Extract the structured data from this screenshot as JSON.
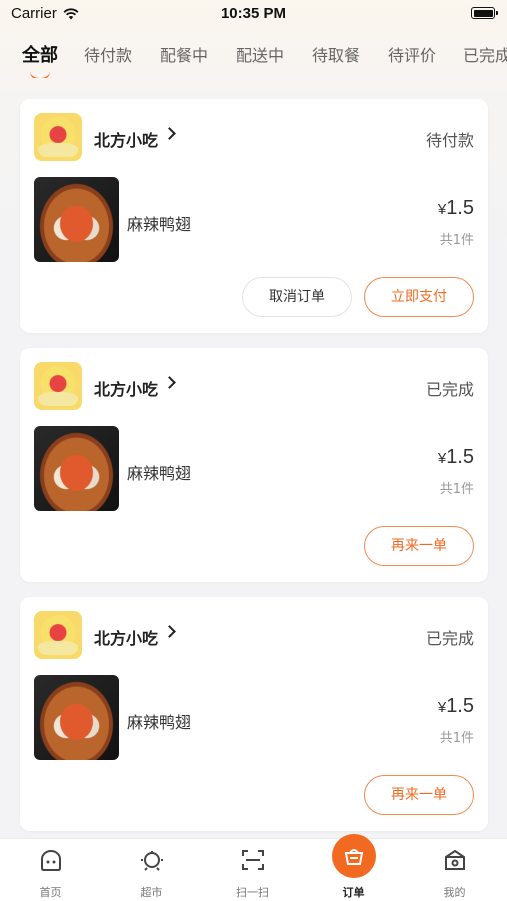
{
  "status_bar": {
    "carrier": "Carrier",
    "time": "10:35 PM"
  },
  "tabs": [
    "全部",
    "待付款",
    "配餐中",
    "配送中",
    "待取餐",
    "待评价",
    "已完成"
  ],
  "active_tab": 0,
  "orders": [
    {
      "shop_name": "北方小吃",
      "status": "待付款",
      "dish_name": "麻辣鸭翅",
      "currency": "¥",
      "price": "1.5",
      "count": "共1件",
      "actions": [
        "取消订单",
        "立即支付"
      ]
    },
    {
      "shop_name": "北方小吃",
      "status": "已完成",
      "dish_name": "麻辣鸭翅",
      "currency": "¥",
      "price": "1.5",
      "count": "共1件",
      "actions": [
        "再来一单"
      ]
    },
    {
      "shop_name": "北方小吃",
      "status": "已完成",
      "dish_name": "麻辣鸭翅",
      "currency": "¥",
      "price": "1.5",
      "count": "共1件",
      "actions": [
        "再来一单"
      ]
    }
  ],
  "tabbar": [
    {
      "label": "首页",
      "icon": "home-icon"
    },
    {
      "label": "超市",
      "icon": "supermarket-icon"
    },
    {
      "label": "扫一扫",
      "icon": "scan-icon"
    },
    {
      "label": "订单",
      "icon": "orders-icon",
      "active": true
    },
    {
      "label": "我的",
      "icon": "profile-icon"
    }
  ],
  "colors": {
    "accent": "#f26a22",
    "background": "#f3f3f5"
  }
}
